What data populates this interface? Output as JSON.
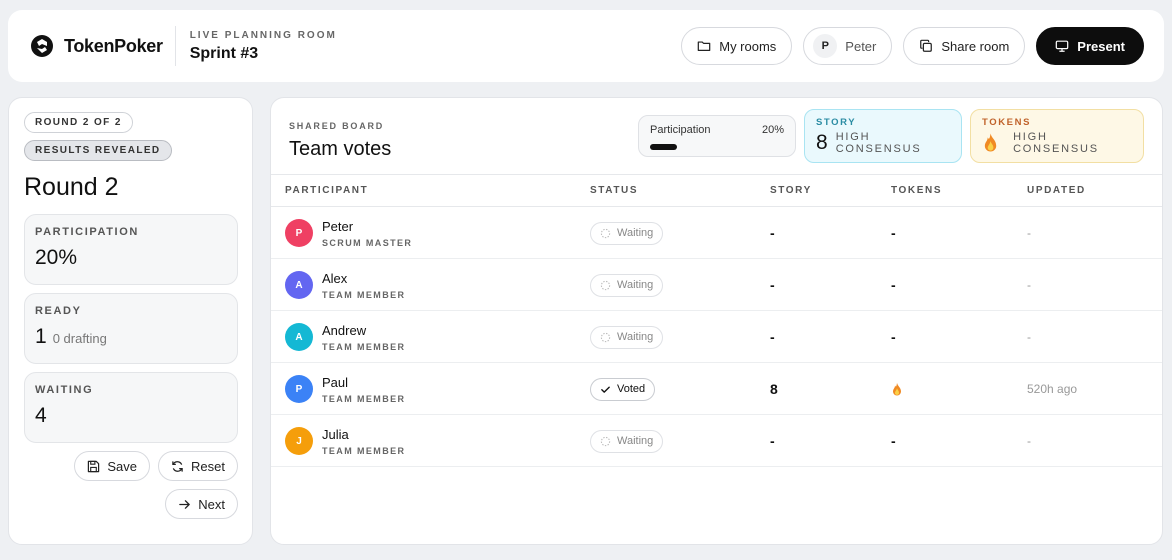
{
  "header": {
    "brand": "TokenPoker",
    "room_kicker": "LIVE PLANNING ROOM",
    "room_name": "Sprint #3",
    "my_rooms_label": "My rooms",
    "user_initial": "P",
    "user_name": "Peter",
    "share_label": "Share room",
    "present_label": "Present"
  },
  "left": {
    "round_badge": "ROUND 2 OF 2",
    "state_badge": "RESULTS REVEALED",
    "round_title": "Round 2",
    "stats": [
      {
        "label": "PARTICIPATION",
        "value": "20%",
        "sub": ""
      },
      {
        "label": "READY",
        "value": "1",
        "sub": "0 drafting"
      },
      {
        "label": "WAITING",
        "value": "4",
        "sub": ""
      }
    ],
    "save_label": "Save",
    "reset_label": "Reset",
    "next_label": "Next"
  },
  "board": {
    "kicker": "SHARED BOARD",
    "title": "Team votes",
    "participation_label": "Participation",
    "participation_value": "20%",
    "participation_fraction": 0.2,
    "story_kicker": "STORY",
    "story_value": "8",
    "story_consensus": "HIGH CONSENSUS",
    "tokens_kicker": "TOKENS",
    "tokens_consensus": "HIGH CONSENSUS",
    "columns": [
      "PARTICIPANT",
      "STATUS",
      "STORY",
      "TOKENS",
      "UPDATED"
    ],
    "rows": [
      {
        "initial": "P",
        "name": "Peter",
        "role": "SCRUM MASTER",
        "status": "Waiting",
        "story": "-",
        "tokens": "-",
        "updated": "-",
        "color": "#ef4063"
      },
      {
        "initial": "A",
        "name": "Alex",
        "role": "TEAM MEMBER",
        "status": "Waiting",
        "story": "-",
        "tokens": "-",
        "updated": "-",
        "color": "#6366f1"
      },
      {
        "initial": "A",
        "name": "Andrew",
        "role": "TEAM MEMBER",
        "status": "Waiting",
        "story": "-",
        "tokens": "-",
        "updated": "-",
        "color": "#14b8d4"
      },
      {
        "initial": "P",
        "name": "Paul",
        "role": "TEAM MEMBER",
        "status": "Voted",
        "story": "8",
        "tokens": "flame-icon",
        "updated": "520h ago",
        "color": "#3b82f6"
      },
      {
        "initial": "J",
        "name": "Julia",
        "role": "TEAM MEMBER",
        "status": "Waiting",
        "story": "-",
        "tokens": "-",
        "updated": "-",
        "color": "#f59e0b"
      }
    ]
  }
}
